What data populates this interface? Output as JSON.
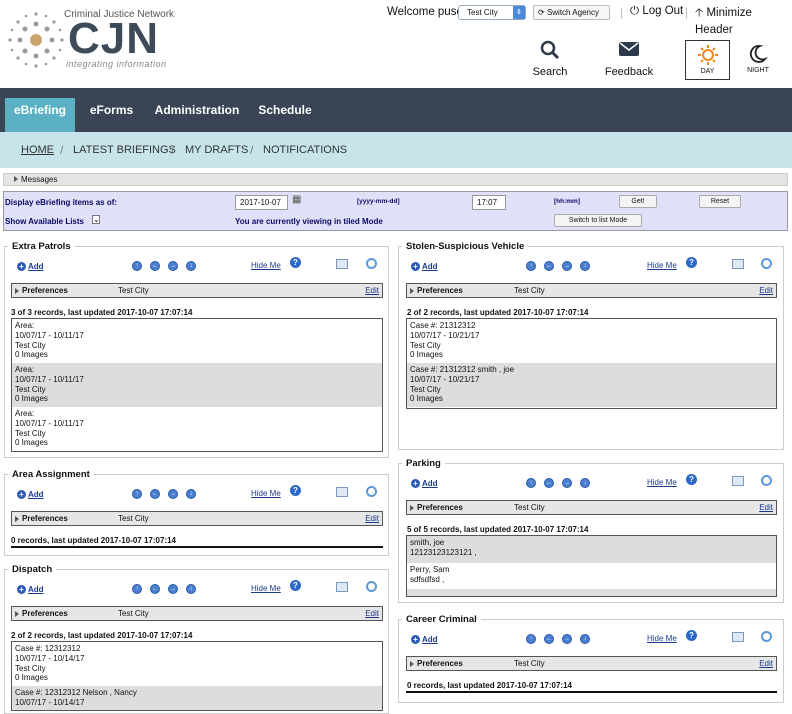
{
  "header": {
    "logo_network": "Criminal Justice Network",
    "logo_name": "CJN",
    "logo_tagline": "integrating information",
    "welcome": "Welcome puser",
    "agency_selected": "Test City",
    "switch_agency": "Switch Agency",
    "logout": "Log Out",
    "minimize": "Minimize Header",
    "search": "Search",
    "feedback": "Feedback",
    "day": "DAY",
    "night": "NIGHT"
  },
  "nav": {
    "tabs": [
      "eBriefing",
      "eForms",
      "Administration",
      "Schedule"
    ],
    "active": "eBriefing"
  },
  "subnav": [
    "HOME",
    "LATEST BRIEFINGS",
    "MY DRAFTS",
    "NOTIFICATIONS"
  ],
  "messages_label": "Messages",
  "controls": {
    "display_label": "Display eBriefing items as of:",
    "date_value": "2017-10-07",
    "date_format": "[yyyy-mm-dd]",
    "time_value": "17:07",
    "time_format": "[hh:mm]",
    "get_button": "Get!",
    "reset_button": "Reset",
    "show_lists": "Show Available Lists",
    "viewing_text": "You are currently viewing in tiled   Mode",
    "switch_mode": "Switch to list Mode"
  },
  "common": {
    "add": "Add",
    "hide_me": "Hide Me",
    "preferences": "Preferences",
    "edit": "Edit",
    "city": "Test City"
  },
  "panels": {
    "extra_patrols": {
      "title": "Extra Patrols",
      "count": "3 of 3 records, last updated 2017-10-07 17:07:14",
      "records": [
        [
          "Area:",
          "10/07/17 - 10/11/17",
          "Test City",
          "0 Images"
        ],
        [
          "Area:",
          "10/07/17 - 10/11/17",
          "Test City",
          "0 Images"
        ],
        [
          "Area:",
          "10/07/17 - 10/11/17",
          "Test City",
          "0 Images"
        ]
      ]
    },
    "area_assignment": {
      "title": "Area Assignment",
      "count": "0 records, last updated 2017-10-07 17:07:14"
    },
    "dispatch": {
      "title": "Dispatch",
      "count": "2 of 2 records, last updated 2017-10-07 17:07:14",
      "records": [
        [
          "Case #: 12312312",
          "10/07/17 - 10/14/17",
          "Test City",
          "0 Images"
        ],
        [
          "Case #: 12312312 Nelson , Nancy",
          "10/07/17 - 10/14/17"
        ]
      ]
    },
    "stolen_vehicle": {
      "title": "Stolen-Suspicious Vehicle",
      "count": "2 of 2 records, last updated 2017-10-07 17:07:14",
      "records": [
        [
          "Case #: 21312312",
          "10/07/17 - 10/21/17",
          "Test City",
          "0 Images"
        ],
        [
          "Case #: 21312312 smith , joe",
          "10/07/17 - 10/21/17",
          "Test City",
          "0 Images"
        ]
      ]
    },
    "parking": {
      "title": "Parking",
      "count": "5 of 5 records, last updated 2017-10-07 17:07:14",
      "records": [
        [
          "smith, joe",
          "12123123123121 ,"
        ],
        [
          "Perry, Sam",
          "sdfsdfsd ,"
        ]
      ]
    },
    "career_criminal": {
      "title": "Career Criminal",
      "count": "0 records, last updated 2017-10-07 17:07:14"
    }
  }
}
